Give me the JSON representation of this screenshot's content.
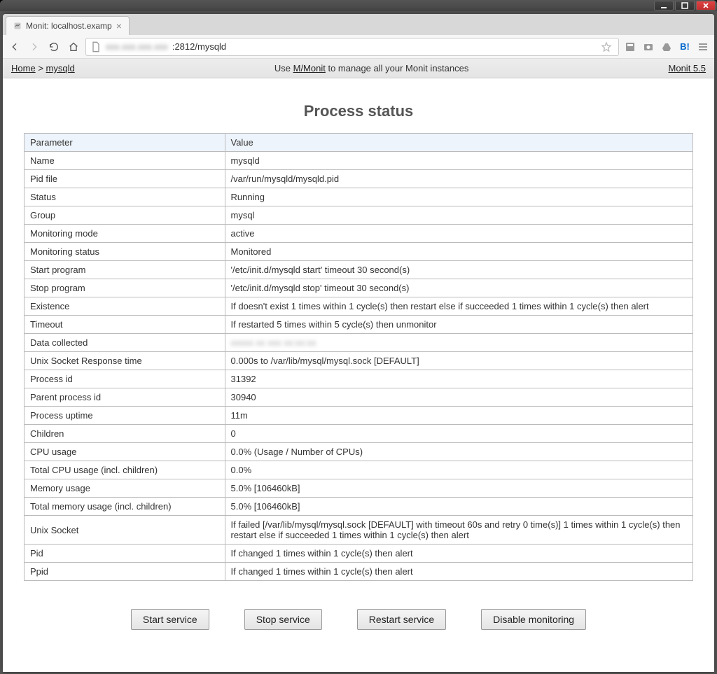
{
  "window": {
    "tab_title": "Monit: localhost.examp",
    "url_blur": "xxx.xxx.xxx.xxx",
    "url_rest": ":2812/mysqld"
  },
  "header": {
    "crumb_home": "Home",
    "crumb_sep": " > ",
    "crumb_current": "mysqld",
    "promo_pre": "Use ",
    "promo_link": "M/Monit",
    "promo_post": " to manage all your Monit instances",
    "version": "Monit 5.5"
  },
  "page_title": "Process status",
  "table_headers": {
    "param": "Parameter",
    "value": "Value"
  },
  "rows": [
    {
      "label": "Name",
      "value": "mysqld"
    },
    {
      "label": "Pid file",
      "value": "/var/run/mysqld/mysqld.pid"
    },
    {
      "label": "Status",
      "value": "Running",
      "style": "running"
    },
    {
      "label": "Group",
      "value": "mysql",
      "style": "link"
    },
    {
      "label": "Monitoring mode",
      "value": "active"
    },
    {
      "label": "Monitoring status",
      "value": "Monitored"
    },
    {
      "label": "Start program",
      "value": "'/etc/init.d/mysqld start' timeout 30 second(s)"
    },
    {
      "label": "Stop program",
      "value": "'/etc/init.d/mysqld stop' timeout 30 second(s)"
    },
    {
      "label": "Existence",
      "value": "If doesn't exist 1 times within 1 cycle(s) then restart else if succeeded 1 times within 1 cycle(s) then alert"
    },
    {
      "label": "Timeout",
      "value": "If restarted 5 times within 5 cycle(s) then unmonitor"
    },
    {
      "label": "Data collected",
      "value": "xxxxx xx xxx xx:xx:xx",
      "style": "blur"
    },
    {
      "label": "Unix Socket Response time",
      "value": "0.000s to /var/lib/mysql/mysql.sock [DEFAULT]"
    },
    {
      "label": "Process id",
      "value": "31392"
    },
    {
      "label": "Parent process id",
      "value": "30940"
    },
    {
      "label": "Process uptime",
      "value": "11m"
    },
    {
      "label": "Children",
      "value": "0"
    },
    {
      "label": "CPU usage",
      "value": "0.0%   (Usage / Number of CPUs)"
    },
    {
      "label": "Total CPU usage (incl. children)",
      "value": "0.0%"
    },
    {
      "label": "Memory usage",
      "value": "5.0% [106460kB]"
    },
    {
      "label": "Total memory usage (incl. children)",
      "value": "5.0% [106460kB]"
    },
    {
      "label": "Unix Socket",
      "value": "If failed [/var/lib/mysql/mysql.sock [DEFAULT] with timeout 60s and retry 0 time(s)] 1 times within 1 cycle(s) then restart else if succeeded 1 times within 1 cycle(s) then alert"
    },
    {
      "label": "Pid",
      "value": "If changed 1 times within 1 cycle(s) then alert"
    },
    {
      "label": "Ppid",
      "value": "If changed 1 times within 1 cycle(s) then alert"
    }
  ],
  "buttons": {
    "start": "Start service",
    "stop": "Stop service",
    "restart": "Restart service",
    "disable": "Disable monitoring"
  }
}
